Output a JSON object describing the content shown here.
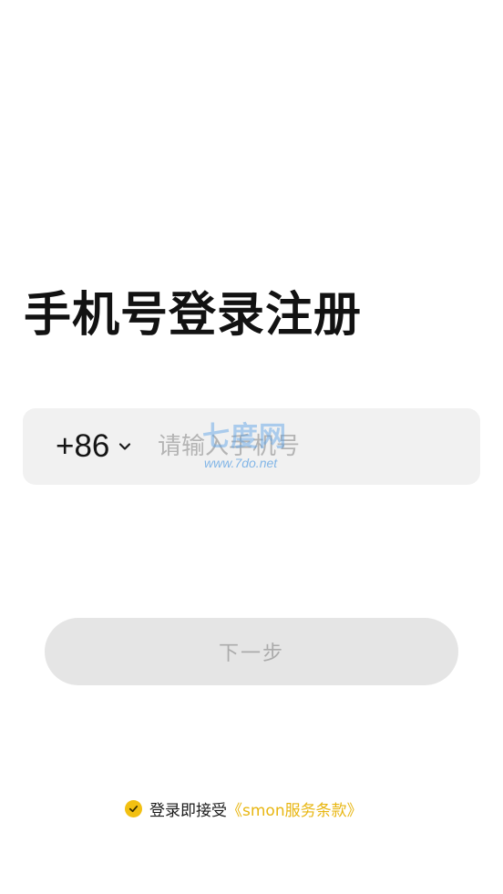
{
  "page_title": "手机号登录注册",
  "phone": {
    "country_code": "+86",
    "placeholder": "请输入手机号",
    "value": ""
  },
  "watermark": {
    "main": "七度网",
    "sub": "www.7do.net"
  },
  "next_button": {
    "label": "下一步",
    "enabled": false
  },
  "agreement": {
    "checked": true,
    "prefix": "登录即接受",
    "terms_link": "《smon服务条款》",
    "check_color": "#f2c012",
    "link_color": "#e8b611"
  },
  "icons": {
    "country_dropdown": "chevron-down-icon",
    "agreement_checkbox": "check-icon"
  }
}
